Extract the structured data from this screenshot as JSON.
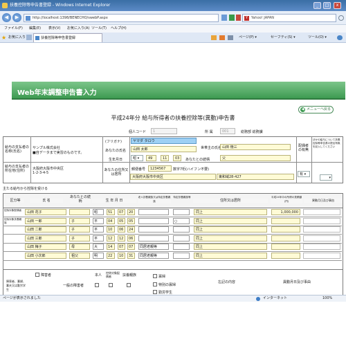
{
  "window": {
    "title": "扶養控除等申告書登録 - Windows Internet Explorer",
    "min": "_",
    "max": "□",
    "close": "x"
  },
  "address": {
    "url": "http://localhost:1398/BENECHO/swebP.aspx",
    "search_placeholder": "Yahoo! JAPAN",
    "back": "◀",
    "forward": "▶"
  },
  "menubar": [
    "ファイル(F)",
    "編集(E)",
    "表示(V)",
    "お気に入り(A)",
    "ツール(T)",
    "ヘルプ(H)"
  ],
  "favorites": {
    "label": "お気に入り"
  },
  "tab": {
    "label": "扶養控除等申告書登録"
  },
  "commandbar": [
    "ページ(P) ▾",
    "セーフティ(S) ▾",
    "ツール(O) ▾"
  ],
  "banner": {
    "title": "Web年末調整申告書入力"
  },
  "menu_back": {
    "label": "メニューへ戻る"
  },
  "form": {
    "title": "平成24年分 給与所得者の扶養控除等(異動)申告書"
  },
  "personal": {
    "code_label": "個人コード",
    "code_value": "1",
    "dept_label": "所 属",
    "dept_code": "001",
    "dept_name": "総務部 総務課"
  },
  "applicant": {
    "payer_name_label": "給与の支払者の名称(氏名)",
    "payer_name_value": "サンプル株式会社",
    "payer_note": "■自データまで実習のものです。",
    "payer_addr_label": "給与の支払者の所在地(住所)",
    "payer_addr_value": "大阪府大阪市中央区",
    "payer_addr_line2": "1-2-3-4-5",
    "furigana_label": "(フリガナ)",
    "furigana_value": "ヤマダ タロウ",
    "name_label": "あなたの氏名",
    "name_value": "山田 太郎",
    "birth_label": "生年月日",
    "birth_era": "昭",
    "birth_y": "49",
    "birth_m": "11",
    "birth_d": "03",
    "household_label": "世帯主の氏名",
    "household_value": "山田 徳三",
    "relation_label": "あなたとの続柄",
    "relation_value": "父",
    "spouse_label": "配偶者の有無",
    "spouse_value": "有",
    "address_label": "あなたの住所又は居所",
    "zip_label": "郵便番号",
    "zip_value": "1234567",
    "zip_note": "数字7桁(ハイフン不要)",
    "addr_value": "大阪府大阪市中央区",
    "addr_value2": "東和域28-427",
    "side_note": "ほかの給与について扶養控除等申告書の提出有無を記入してください"
  },
  "section": {
    "label": "主たる給与から控除を受ける"
  },
  "table": {
    "headers": [
      "区分等",
      "氏 名",
      "あなたとの続柄",
      "生 年 月 日",
      "老人扶養親族又は特定扶養親族",
      "特定扶養親族等",
      "住所又は居所",
      "平成24年中の所得の見積額(円)",
      "異動月日及び事由"
    ],
    "rows": [
      {
        "group": "控除対象配偶者",
        "name": "山田 花子",
        "rel": "",
        "era": "昭",
        "y": "51",
        "m": "07",
        "d": "20",
        "cls1": "",
        "cls2": "",
        "addr": "同上",
        "income": "1,000,000"
      },
      {
        "group": "控除対象扶養親族",
        "name": "山田 一郎",
        "rel": "子",
        "era": "平",
        "y": "04",
        "m": "05",
        "d": "05",
        "cls1": "",
        "cls2": "○",
        "addr": "同上",
        "income": ""
      },
      {
        "group": "",
        "name": "山田 二郎",
        "rel": "子",
        "era": "平",
        "y": "10",
        "m": "06",
        "d": "24",
        "cls1": "",
        "cls2": "",
        "addr": "同上",
        "income": ""
      },
      {
        "group": "",
        "name": "山田 三郎",
        "rel": "子",
        "era": "平",
        "y": "12",
        "m": "12",
        "d": "06",
        "cls1": "",
        "cls2": "",
        "addr": "同上",
        "income": ""
      },
      {
        "group": "",
        "name": "山田 梅子",
        "rel": "母",
        "era": "大",
        "y": "14",
        "m": "07",
        "d": "07",
        "cls1": "同居老親等",
        "cls2": "",
        "addr": "同上",
        "income": ""
      },
      {
        "group": "",
        "name": "山田 小次郎",
        "rel": "祖父",
        "era": "明",
        "y": "22",
        "m": "10",
        "d": "31",
        "cls1": "同居老親等",
        "cls2": "",
        "addr": "同上",
        "income": ""
      }
    ]
  },
  "lower": {
    "disabled_label": "障害者",
    "self_label": "本人",
    "spouse_label": "控除対象配偶者",
    "dep_label": "扶養親族",
    "general_label": "一般の障害者",
    "widow_label": "寡婦",
    "special_widow_label": "特別の寡婦",
    "student_label": "勤労学生",
    "left_label": "障害者、寡婦、寡夫又は勤労学生",
    "content_label": "左記の内容",
    "change_label": "異動月日及び事由"
  },
  "status": {
    "text": "ページが表示されました",
    "zone": "インターネット",
    "zoom": "100%"
  }
}
